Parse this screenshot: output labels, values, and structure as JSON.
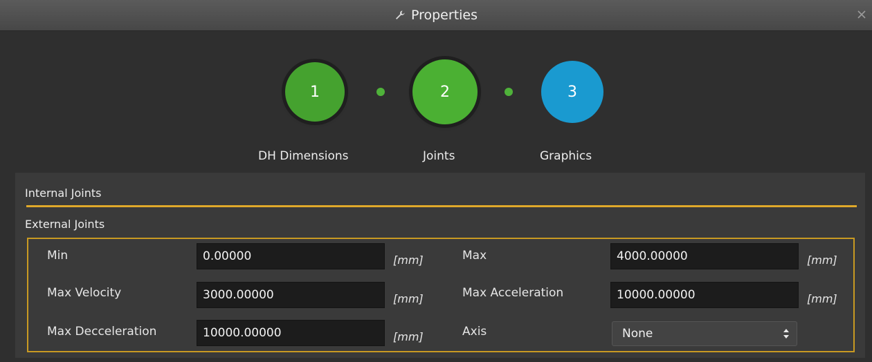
{
  "window": {
    "title": "Properties",
    "title_icon": "wrench-icon",
    "close_icon": "close-icon"
  },
  "stepper": {
    "steps": [
      {
        "number": "1",
        "label": "DH Dimensions",
        "state": "completed",
        "color": "#45a22f"
      },
      {
        "number": "2",
        "label": "Joints",
        "state": "current",
        "color": "#4bb033"
      },
      {
        "number": "3",
        "label": "Graphics",
        "state": "upcoming",
        "color": "#1a9ad0"
      }
    ]
  },
  "sections": {
    "internal": "Internal Joints",
    "external": "External Joints"
  },
  "fields": {
    "min": {
      "label": "Min",
      "value": "0.00000",
      "unit": "[mm]"
    },
    "max": {
      "label": "Max",
      "value": "4000.00000",
      "unit": "[mm]"
    },
    "max_velocity": {
      "label": "Max Velocity",
      "value": "3000.00000",
      "unit": "[mm]"
    },
    "max_acceleration": {
      "label": "Max Acceleration",
      "value": "10000.00000",
      "unit": "[mm]"
    },
    "max_decceleration": {
      "label": "Max Decceleration",
      "value": "10000.00000",
      "unit": "[mm]"
    },
    "axis": {
      "label": "Axis",
      "value": "None"
    }
  },
  "colors": {
    "accent": "#e0a92a",
    "green": "#45a22f",
    "blue": "#1a9ad0"
  }
}
